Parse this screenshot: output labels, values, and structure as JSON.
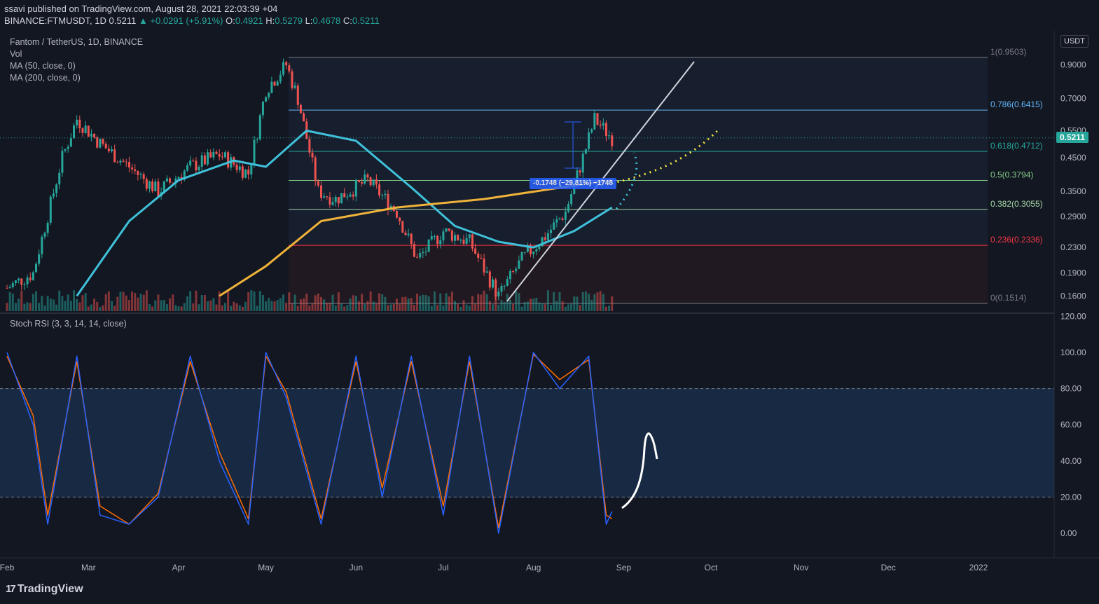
{
  "header": {
    "published": "ssavi published on TradingView.com, August 28, 2021 22:03:39 +04",
    "symbol": "BINANCE:FTMUSDT, 1D",
    "last": "0.5211",
    "change": "▲ +0.0291 (+5.91%)",
    "o_label": "O:",
    "o": "0.4921",
    "h_label": "H:",
    "h": "0.5279",
    "l_label": "L:",
    "l": "0.4678",
    "c_label": "C:",
    "c": "0.5211"
  },
  "legend": {
    "title": "Fantom / TetherUS, 1D, BINANCE",
    "vol": "Vol",
    "ma50": "MA (50, close, 0)",
    "ma200": "MA (200, close, 0)",
    "stoch": "Stoch RSI (3, 3, 14, 14, close)"
  },
  "price_axis": {
    "currency": "USDT",
    "current_price_tag": "0.5211",
    "ticks": [
      "0.9000",
      "0.7000",
      "0.5500",
      "0.4500",
      "0.3500",
      "0.2900",
      "0.2300",
      "0.1900",
      "0.1600"
    ]
  },
  "stoch_axis": {
    "ticks": [
      "120.00",
      "100.00",
      "80.00",
      "60.00",
      "40.00",
      "20.00",
      "0.00"
    ]
  },
  "time_axis": {
    "ticks": [
      "Feb",
      "Mar",
      "Apr",
      "May",
      "Jun",
      "Jul",
      "Aug",
      "Sep",
      "Oct",
      "Nov",
      "Dec",
      "2022"
    ]
  },
  "fib_levels": [
    {
      "label": "1(0.9503)",
      "value": 0.9503,
      "color": "#787b86"
    },
    {
      "label": "0.786(0.6415)",
      "value": 0.6415,
      "color": "#64b5f6"
    },
    {
      "label": "0.618(0.4712)",
      "value": 0.4712,
      "color": "#26a69a"
    },
    {
      "label": "0.5(0.3794)",
      "value": 0.3794,
      "color": "#81c784"
    },
    {
      "label": "0.382(0.3055)",
      "value": 0.3055,
      "color": "#a5d6a7"
    },
    {
      "label": "0.236(0.2336)",
      "value": 0.2336,
      "color": "#f23645"
    },
    {
      "label": "0(0.1514)",
      "value": 0.1514,
      "color": "#787b86"
    }
  ],
  "measure_label": "-0.1748 (−29.81%) −1748",
  "chart_data": [
    {
      "type": "line",
      "title": "Fantom / TetherUS, 1D, BINANCE",
      "x_range": [
        "2021-02-01",
        "2022-01-01"
      ],
      "y_scale": "log",
      "y_ticks": [
        0.16,
        0.19,
        0.23,
        0.29,
        0.35,
        0.45,
        0.55,
        0.7,
        0.9
      ],
      "series": [
        {
          "name": "FTMUSDT",
          "kind": "close",
          "x": [
            "2021-02-01",
            "2021-02-10",
            "2021-02-20",
            "2021-02-25",
            "2021-03-05",
            "2021-03-15",
            "2021-03-25",
            "2021-04-05",
            "2021-04-15",
            "2021-04-25",
            "2021-05-01",
            "2021-05-08",
            "2021-05-12",
            "2021-05-19",
            "2021-05-25",
            "2021-06-05",
            "2021-06-15",
            "2021-06-22",
            "2021-07-01",
            "2021-07-10",
            "2021-07-20",
            "2021-07-28",
            "2021-08-05",
            "2021-08-12",
            "2021-08-18",
            "2021-08-22",
            "2021-08-28"
          ],
          "y": [
            0.17,
            0.19,
            0.45,
            0.6,
            0.5,
            0.42,
            0.35,
            0.42,
            0.46,
            0.4,
            0.75,
            0.9,
            0.7,
            0.35,
            0.33,
            0.38,
            0.3,
            0.21,
            0.26,
            0.24,
            0.16,
            0.21,
            0.25,
            0.3,
            0.45,
            0.6,
            0.5211
          ]
        },
        {
          "name": "MA (50, close, 0)",
          "x": [
            "2021-02-25",
            "2021-03-15",
            "2021-04-01",
            "2021-04-20",
            "2021-05-01",
            "2021-05-15",
            "2021-06-01",
            "2021-06-20",
            "2021-07-05",
            "2021-07-20",
            "2021-08-01",
            "2021-08-15",
            "2021-08-28"
          ],
          "y": [
            0.16,
            0.28,
            0.38,
            0.44,
            0.42,
            0.55,
            0.51,
            0.36,
            0.27,
            0.24,
            0.23,
            0.26,
            0.31
          ]
        },
        {
          "name": "MA (200, close, 0)",
          "x": [
            "2021-04-15",
            "2021-05-01",
            "2021-05-20",
            "2021-06-15",
            "2021-07-15",
            "2021-08-15",
            "2021-08-28"
          ],
          "y": [
            0.16,
            0.2,
            0.28,
            0.31,
            0.33,
            0.365,
            0.38
          ]
        }
      ]
    },
    {
      "type": "line",
      "title": "Stoch RSI (3, 3, 14, 14, close)",
      "ylim": [
        0,
        120
      ],
      "y_ticks": [
        0,
        20,
        40,
        60,
        80,
        100,
        120
      ],
      "bands": [
        20,
        80
      ],
      "series": [
        {
          "name": "K",
          "x": [
            "2021-02-01",
            "2021-02-10",
            "2021-02-15",
            "2021-02-25",
            "2021-03-05",
            "2021-03-15",
            "2021-03-25",
            "2021-04-05",
            "2021-04-15",
            "2021-04-25",
            "2021-05-01",
            "2021-05-08",
            "2021-05-20",
            "2021-06-01",
            "2021-06-10",
            "2021-06-20",
            "2021-07-01",
            "2021-07-10",
            "2021-07-20",
            "2021-08-01",
            "2021-08-10",
            "2021-08-20",
            "2021-08-26",
            "2021-08-28"
          ],
          "y": [
            100,
            60,
            5,
            98,
            10,
            5,
            20,
            98,
            40,
            5,
            100,
            75,
            5,
            98,
            20,
            98,
            10,
            98,
            0,
            100,
            80,
            98,
            5,
            12
          ]
        },
        {
          "name": "D",
          "x": [
            "2021-02-01",
            "2021-02-10",
            "2021-02-15",
            "2021-02-25",
            "2021-03-05",
            "2021-03-15",
            "2021-03-25",
            "2021-04-05",
            "2021-04-15",
            "2021-04-25",
            "2021-05-01",
            "2021-05-08",
            "2021-05-20",
            "2021-06-01",
            "2021-06-10",
            "2021-06-20",
            "2021-07-01",
            "2021-07-10",
            "2021-07-20",
            "2021-08-01",
            "2021-08-10",
            "2021-08-20",
            "2021-08-26",
            "2021-08-28"
          ],
          "y": [
            98,
            65,
            10,
            95,
            15,
            5,
            22,
            95,
            45,
            8,
            98,
            78,
            8,
            95,
            25,
            95,
            15,
            95,
            3,
            99,
            85,
            96,
            10,
            8
          ]
        }
      ]
    }
  ],
  "colors": {
    "background": "#131722",
    "up": "#26a69a",
    "down": "#ef5350",
    "ma50": "#3fc1d9",
    "ma200": "#f0b33a",
    "stoch_k": "#2962ff",
    "stoch_d": "#ff6d00",
    "band_fill": "#1e3a5f"
  }
}
